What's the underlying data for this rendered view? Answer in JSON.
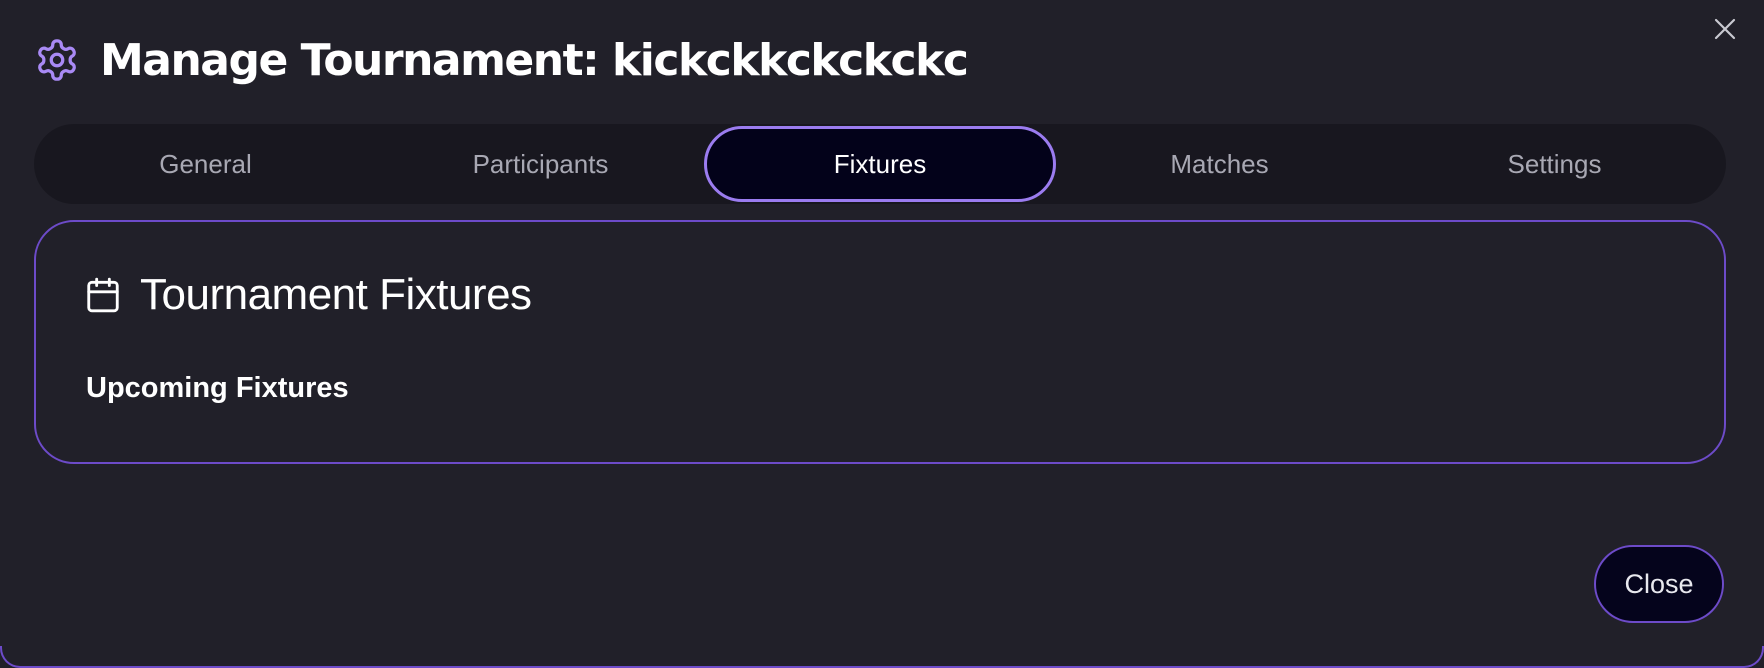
{
  "dialog": {
    "title": "Manage Tournament: kickckkckckckc",
    "icon": "gear-icon",
    "close_icon": "close-icon"
  },
  "tabs": [
    {
      "label": "General",
      "active": false
    },
    {
      "label": "Participants",
      "active": false
    },
    {
      "label": "Fixtures",
      "active": true
    },
    {
      "label": "Matches",
      "active": false
    },
    {
      "label": "Settings",
      "active": false
    }
  ],
  "fixtures_panel": {
    "icon": "calendar-icon",
    "title": "Tournament Fixtures",
    "subheading": "Upcoming Fixtures"
  },
  "footer": {
    "close_label": "Close"
  },
  "colors": {
    "background": "#212029",
    "accent": "#9b7cf0",
    "border": "#6d4bc9",
    "tab_bar": "#18171f",
    "active_tab_bg": "#03021a"
  }
}
